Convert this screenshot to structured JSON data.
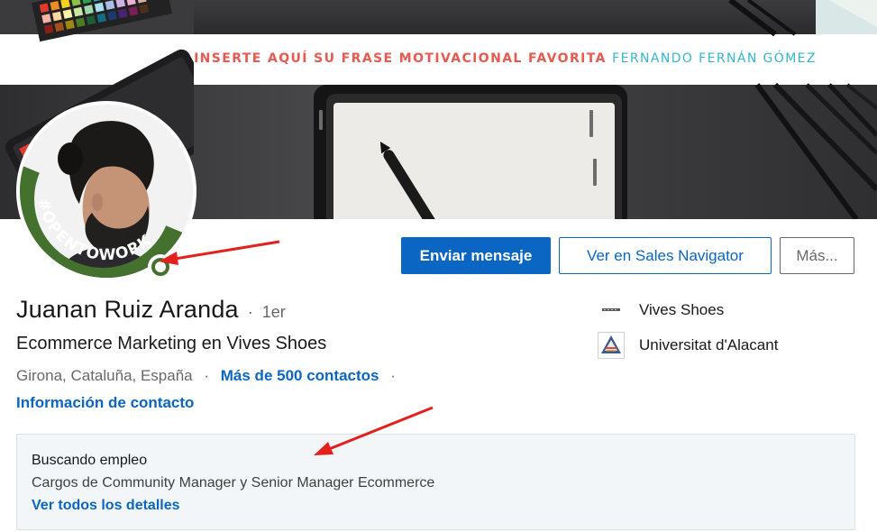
{
  "banner": {
    "quote_main": "INSERTE AQUÍ SU FRASE MOTIVACIONAL FAVORITA",
    "quote_author": "FERNANDO FERNÁN  GÓMEZ",
    "accent_red": "#e8594f",
    "accent_teal": "#35b5cf"
  },
  "avatar": {
    "badge_text": "#OPENTOWORK",
    "badge_color": "#44712e",
    "status_icon": "open-to-work-ring-icon"
  },
  "actions": {
    "message_label": "Enviar mensaje",
    "sales_navigator_label": "Ver en Sales Navigator",
    "more_label": "Más..."
  },
  "profile": {
    "name": "Juanan Ruiz Aranda",
    "separator": "·",
    "degree": "1er",
    "headline": "Ecommerce Marketing en Vives Shoes",
    "location": "Girona, Cataluña, España",
    "location_separator": "·",
    "connections": "Más de 500 contactos",
    "trailing_separator": "·",
    "contact_info": "Información de contacto"
  },
  "right_column": {
    "company": {
      "label": "Vives Shoes",
      "icon": "company-logo-icon"
    },
    "school": {
      "label": "Universitat d'Alacant",
      "icon": "university-logo-icon"
    }
  },
  "open_to_work": {
    "title": "Buscando empleo",
    "description": "Cargos de Community Manager y Senior Manager Ecommerce",
    "details_link": "Ver todos los detalles"
  },
  "colors": {
    "brand_blue": "#0a66c2",
    "annotation_red": "#e3211c"
  }
}
